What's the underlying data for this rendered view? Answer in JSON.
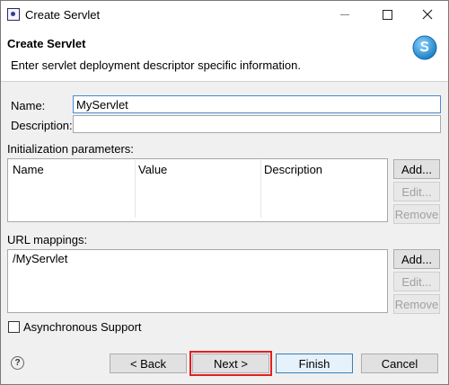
{
  "window": {
    "title": "Create Servlet"
  },
  "header": {
    "title": "Create Servlet",
    "message": "Enter servlet deployment descriptor specific information."
  },
  "form": {
    "name_label": "Name:",
    "name_value": "MyServlet",
    "description_label": "Description:",
    "description_value": ""
  },
  "init_params": {
    "label": "Initialization parameters:",
    "columns": [
      "Name",
      "Value",
      "Description"
    ],
    "add_label": "Add...",
    "edit_label": "Edit...",
    "remove_label": "Remove"
  },
  "url_mappings": {
    "label": "URL mappings:",
    "items": [
      "/MyServlet"
    ],
    "add_label": "Add...",
    "edit_label": "Edit...",
    "remove_label": "Remove"
  },
  "async": {
    "label": "Asynchronous Support",
    "checked": false
  },
  "footer": {
    "help_glyph": "?",
    "back_label": "< Back",
    "next_label": "Next >",
    "finish_label": "Finish",
    "cancel_label": "Cancel"
  },
  "icons": {
    "app": "eclipse-window-icon",
    "wizard": "servlet-wizard-icon",
    "help": "help-icon"
  },
  "colors": {
    "focus_border": "#4a8ad0",
    "default_button_border": "#3c7fb1",
    "highlight_outline": "#e02020",
    "wizard_logo": "#2b9ad6"
  }
}
